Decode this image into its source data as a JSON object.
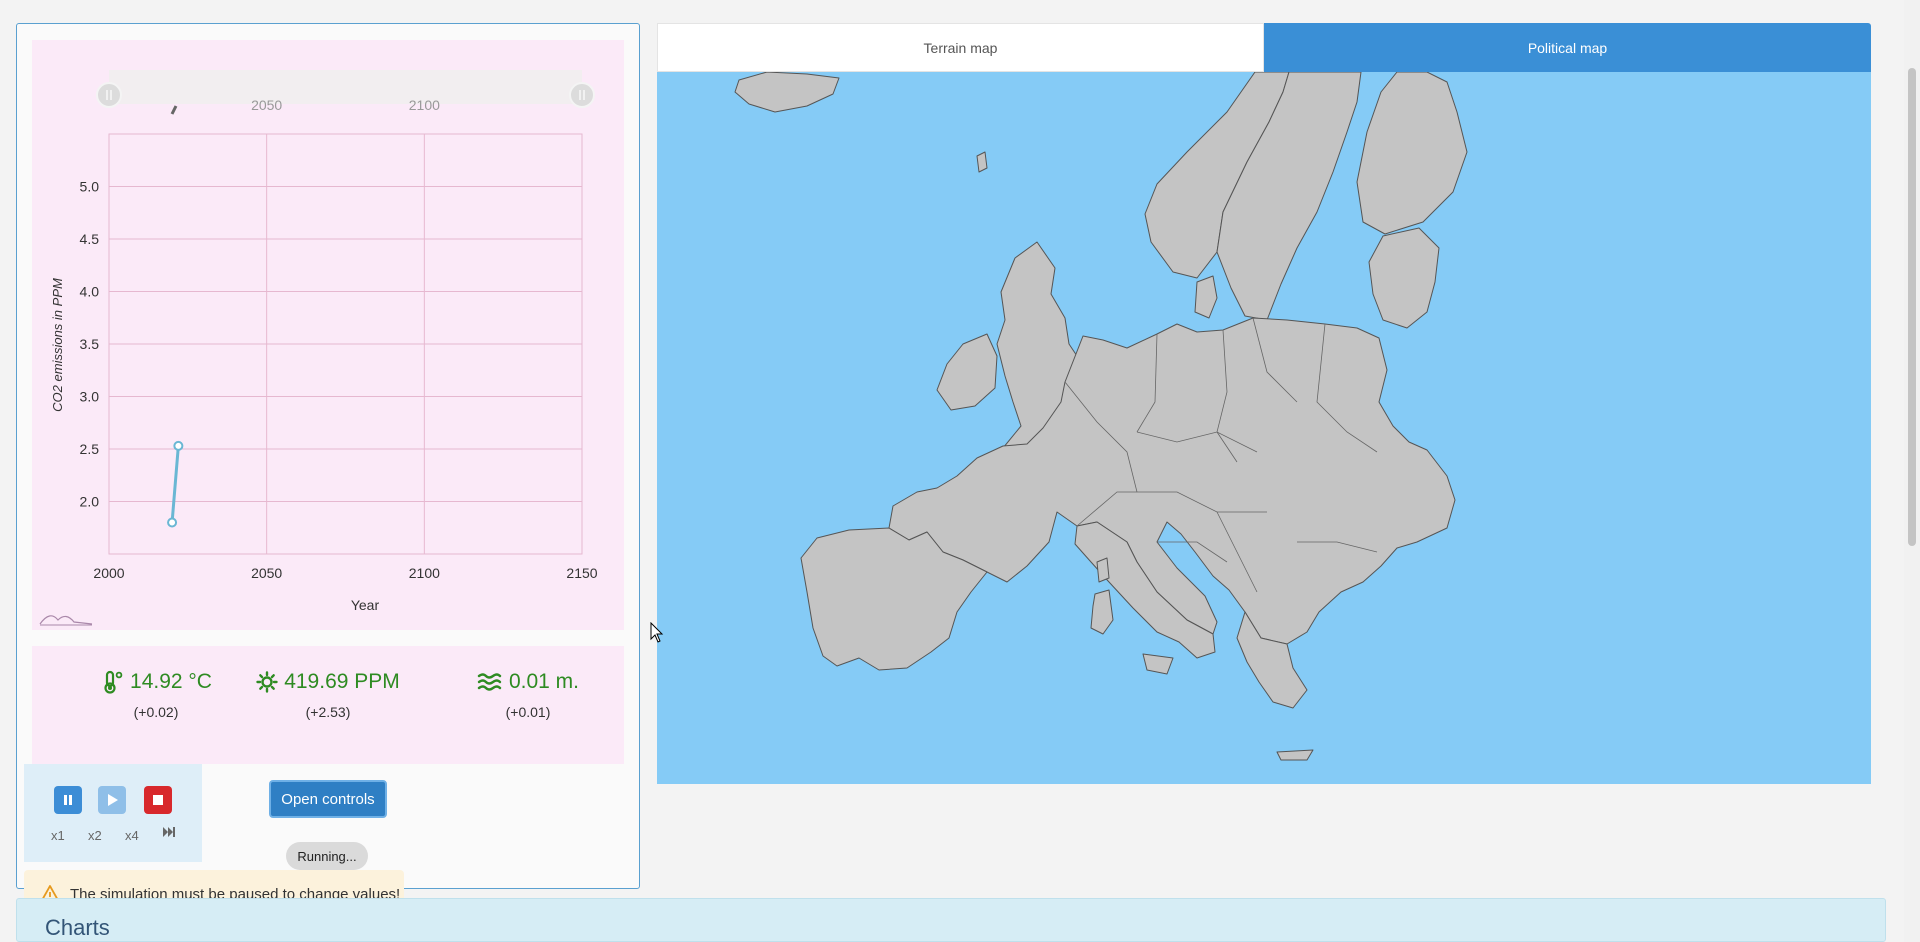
{
  "chart_data": {
    "type": "line",
    "series": [
      {
        "x": [
          2020,
          2022
        ],
        "y": [
          1.8,
          2.53
        ]
      }
    ],
    "xlabel": "Year",
    "ylabel": "CO2 emissions in PPM",
    "xlim": [
      2000,
      2150
    ],
    "ylim": [
      1.5,
      5.5
    ],
    "x_ticks": [
      2000,
      2050,
      2100,
      2150
    ],
    "y_ticks": [
      "2.0",
      "2.5",
      "3.0",
      "3.5",
      "4.0",
      "4.5",
      "5.0"
    ],
    "range_slider_ticks": [
      "2050",
      "2100"
    ],
    "grid": true
  },
  "stats": {
    "temperature": {
      "value": "14.92 °C",
      "delta": "(+0.02)",
      "icon": "thermometer-icon",
      "color": "#2e8b22"
    },
    "co2": {
      "value": "419.69 PPM",
      "delta": "(+2.53)",
      "icon": "sun-icon",
      "color": "#2e8b22"
    },
    "sea": {
      "value": "0.01 m.",
      "delta": "(+0.01)",
      "icon": "waves-icon",
      "color": "#2e8b22"
    }
  },
  "controls": {
    "speeds": [
      "x1",
      "x2",
      "x4"
    ],
    "open_controls": "Open controls",
    "status": "Running...",
    "warning": "The simulation must be paused to change values!"
  },
  "map": {
    "tabs": [
      "Terrain map",
      "Political map"
    ],
    "active_tab": "Political map"
  },
  "sections": {
    "charts": "Charts"
  }
}
